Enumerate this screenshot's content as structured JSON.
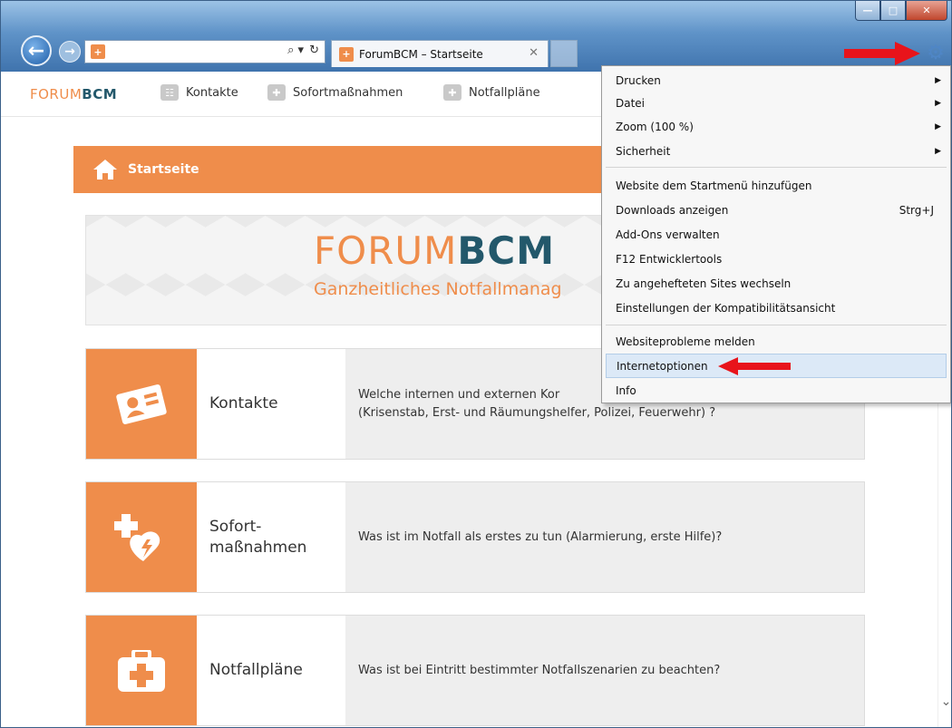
{
  "browser": {
    "address_placeholder": "",
    "address_tools": [
      "⌕ ▾",
      "↻"
    ],
    "tab_title": "ForumBCM – Startseite",
    "tab_close": "✕",
    "window_buttons": [
      "—",
      "□",
      "✕"
    ]
  },
  "site": {
    "logo_part1": "FORUM",
    "logo_part2": "BCM",
    "nav": [
      {
        "label": "Kontakte"
      },
      {
        "label": "Sofortmaßnahmen"
      },
      {
        "label": "Notfallpläne"
      }
    ]
  },
  "page": {
    "breadcrumb": "Startseite",
    "banner_title_1": "FORUM",
    "banner_title_2": "BCM",
    "banner_subtitle": "Ganzheitliches Notfallmanag",
    "cards": [
      {
        "title": "Kontakte",
        "desc": "Welche internen und externen Kor\n(Krisenstab, Erst- und Räumungshelfer, Polizei, Feuerwehr) ?"
      },
      {
        "title": "Sofort-\nmaßnahmen",
        "desc": "Was ist im Notfall als erstes zu tun (Alarmierung, erste Hilfe)?"
      },
      {
        "title": "Notfallpläne",
        "desc": "Was ist bei Eintritt bestimmter Notfallszenarien zu beachten?"
      }
    ]
  },
  "menu": {
    "items": [
      {
        "label": "Drucken",
        "submenu": true
      },
      {
        "label": "Datei",
        "submenu": true
      },
      {
        "label": "Zoom (100 %)",
        "submenu": true
      },
      {
        "label": "Sicherheit",
        "submenu": true
      },
      {
        "label": "Website dem Startmenü hinzufügen"
      },
      {
        "label": "Downloads anzeigen",
        "shortcut": "Strg+J"
      },
      {
        "label": "Add-Ons verwalten"
      },
      {
        "label": "F12 Entwicklertools"
      },
      {
        "label": "Zu angehefteten Sites wechseln"
      },
      {
        "label": "Einstellungen der Kompatibilitätsansicht"
      },
      {
        "label": "Websiteprobleme melden"
      },
      {
        "label": "Internetoptionen",
        "highlighted": true
      },
      {
        "label": "Info"
      }
    ]
  },
  "colors": {
    "accent": "#ef8d4b",
    "brand_dark": "#23586b",
    "arrow": "#e8141b"
  }
}
